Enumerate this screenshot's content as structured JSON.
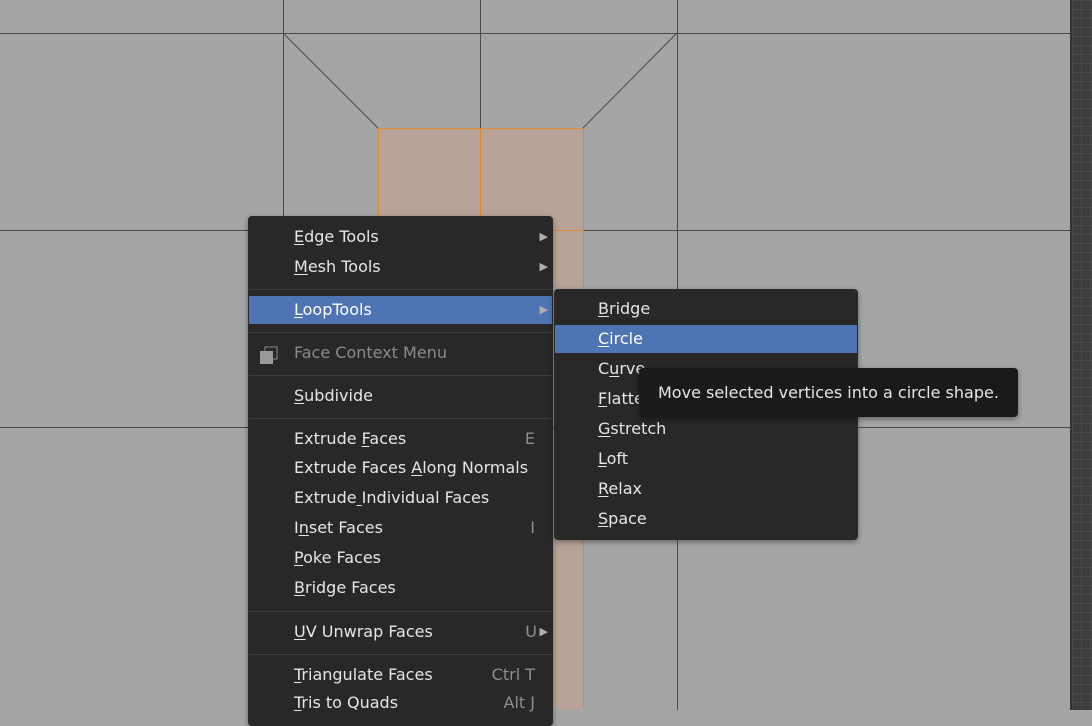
{
  "colors": {
    "viewport_bg": "#a4a5a7",
    "menu_bg": "#282828",
    "highlight": "#4f74b3",
    "face_selected": "#b9a398",
    "face_edge": "#e08a30",
    "tooltip_bg": "#1a1a1a"
  },
  "context_menu": {
    "items": [
      {
        "pre": "",
        "key": "E",
        "post": "dge Tools",
        "shortcut": "",
        "submenu": true
      },
      {
        "pre": "",
        "key": "M",
        "post": "esh Tools",
        "shortcut": "",
        "submenu": true
      },
      {
        "pre": "",
        "key": "L",
        "post": "oopTools",
        "shortcut": "",
        "submenu": true,
        "highlighted": true
      },
      {
        "pre": "Face Context Menu",
        "key": "",
        "post": "",
        "shortcut": "",
        "disabled": true,
        "icon": "face-select-icon"
      },
      {
        "pre": "",
        "key": "S",
        "post": "ubdivide",
        "shortcut": ""
      },
      {
        "pre": "Extrude ",
        "key": "F",
        "post": "aces",
        "shortcut": "E"
      },
      {
        "pre": "Extrude Faces ",
        "key": "A",
        "post": "long Normals",
        "shortcut": ""
      },
      {
        "pre": "Extrude",
        "key": " ",
        "post": "Individual Faces",
        "shortcut": ""
      },
      {
        "pre": "I",
        "key": "n",
        "post": "set Faces",
        "shortcut": "I"
      },
      {
        "pre": "",
        "key": "P",
        "post": "oke Faces",
        "shortcut": ""
      },
      {
        "pre": "",
        "key": "B",
        "post": "ridge Faces",
        "shortcut": ""
      },
      {
        "pre": "",
        "key": "U",
        "post": "V Unwrap Faces",
        "shortcut": "U",
        "submenu": true
      },
      {
        "pre": "",
        "key": "T",
        "post": "riangulate Faces",
        "shortcut": "Ctrl T"
      },
      {
        "pre": "",
        "key": "T",
        "post": "ris to Quads",
        "shortcut": "Alt J"
      }
    ]
  },
  "looptools_menu": {
    "items": [
      {
        "pre": "",
        "key": "B",
        "post": "ridge"
      },
      {
        "pre": "",
        "key": "C",
        "post": "ircle",
        "highlighted": true
      },
      {
        "pre": "C",
        "key": "u",
        "post": "rve"
      },
      {
        "pre": "",
        "key": "F",
        "post": "latten"
      },
      {
        "pre": "",
        "key": "G",
        "post": "stretch"
      },
      {
        "pre": "",
        "key": "L",
        "post": "oft"
      },
      {
        "pre": "",
        "key": "R",
        "post": "elax"
      },
      {
        "pre": "",
        "key": "S",
        "post": "pace"
      }
    ]
  },
  "tooltip": {
    "text": "Move selected vertices into a circle shape."
  }
}
